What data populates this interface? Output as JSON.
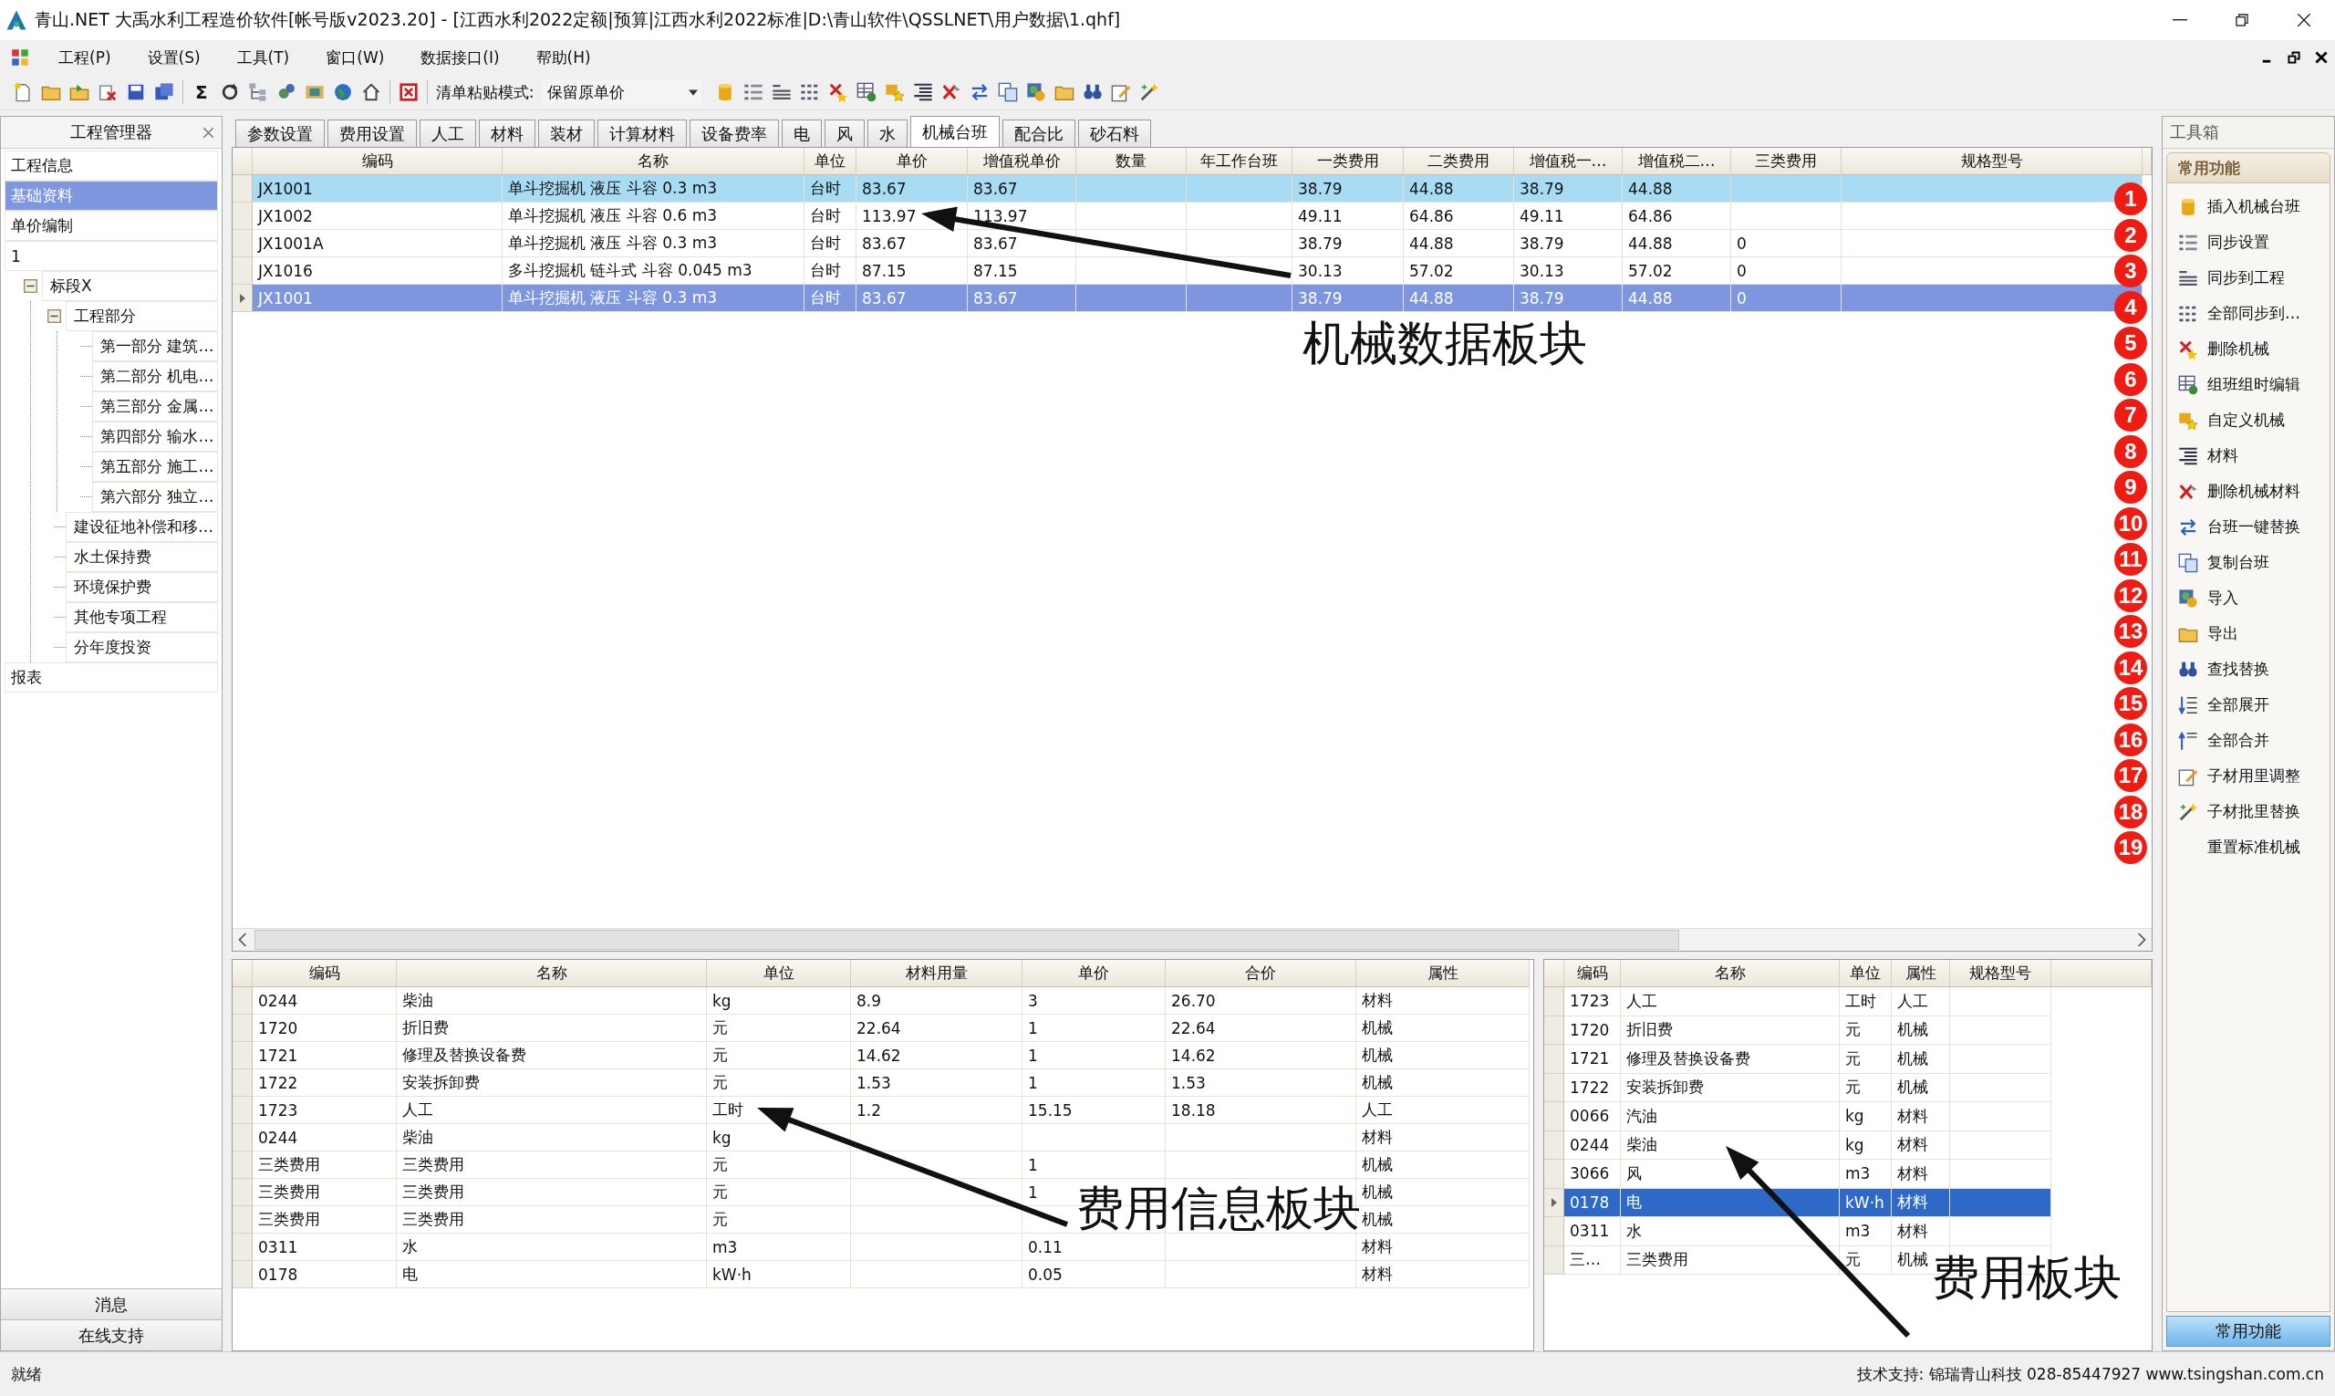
{
  "window": {
    "title": "青山.NET 大禹水利工程造价软件[帐号版v2023.20] - [江西水利2022定额|预算|江西水利2022标准|D:\\青山软件\\QSSLNET\\用户数据\\1.qhf]"
  },
  "menu": [
    "工程(P)",
    "设置(S)",
    "工具(T)",
    "窗口(W)",
    "数据接口(I)",
    "帮助(H)"
  ],
  "toolbar": {
    "sum_glyph": "Σ",
    "paste_mode_label": "清单粘贴模式:",
    "paste_mode_value": "保留原单价"
  },
  "project_manager": {
    "title": "工程管理器",
    "items": [
      {
        "label": "工程信息",
        "selected": false
      },
      {
        "label": "基础资料",
        "selected": true
      },
      {
        "label": "单价编制",
        "selected": false
      },
      {
        "label": "1",
        "selected": false
      },
      {
        "label": "标段X",
        "selected": false,
        "expanded": true,
        "children": [
          {
            "label": "工程部分",
            "selected": false,
            "expanded": true,
            "children": [
              {
                "label": "第一部分 建筑…",
                "selected": false
              },
              {
                "label": "第二部分 机电…",
                "selected": false
              },
              {
                "label": "第三部分 金属…",
                "selected": false
              },
              {
                "label": "第四部分 输水…",
                "selected": false
              },
              {
                "label": "第五部分 施工…",
                "selected": false
              },
              {
                "label": "第六部分 独立…",
                "selected": false
              }
            ]
          },
          {
            "label": "建设征地补偿和移…",
            "selected": false
          },
          {
            "label": "水土保持费",
            "selected": false
          },
          {
            "label": "环境保护费",
            "selected": false
          },
          {
            "label": "其他专项工程",
            "selected": false
          },
          {
            "label": "分年度投资",
            "selected": false
          }
        ]
      },
      {
        "label": "报表",
        "selected": false
      }
    ],
    "footer_buttons": [
      "消息",
      "在线支持"
    ]
  },
  "tabs": [
    {
      "label": "参数设置",
      "selected": false
    },
    {
      "label": "费用设置",
      "selected": false
    },
    {
      "label": "人工",
      "selected": false
    },
    {
      "label": "材料",
      "selected": false
    },
    {
      "label": "装材",
      "selected": false
    },
    {
      "label": "计算材料",
      "selected": false
    },
    {
      "label": "设备费率",
      "selected": false
    },
    {
      "label": "电",
      "selected": false
    },
    {
      "label": "风",
      "selected": false
    },
    {
      "label": "水",
      "selected": false
    },
    {
      "label": "机械台班",
      "selected": true
    },
    {
      "label": "配合比",
      "selected": false
    },
    {
      "label": "砂石料",
      "selected": false
    }
  ],
  "machine_table": {
    "columns": [
      "编码",
      "名称",
      "单位",
      "单价",
      "增值税单价",
      "数量",
      "年工作台班",
      "一类费用",
      "二类费用",
      "增值税一…",
      "增值税二…",
      "三类费用",
      "规格型号"
    ],
    "rows": [
      {
        "cells": [
          "JX1001",
          "单斗挖掘机 液压 斗容 0.3 m3",
          "台时",
          "83.67",
          "83.67",
          null,
          null,
          "38.79",
          "44.88",
          "38.79",
          "44.88",
          null,
          null
        ],
        "selected": false,
        "highlighted": true
      },
      {
        "cells": [
          "JX1002",
          "单斗挖掘机 液压 斗容 0.6 m3",
          "台时",
          "113.97",
          "113.97",
          null,
          null,
          "49.11",
          "64.86",
          "49.11",
          "64.86",
          null,
          null
        ],
        "selected": false,
        "highlighted": false
      },
      {
        "cells": [
          "JX1001A",
          "单斗挖掘机 液压 斗容 0.3 m3",
          "台时",
          "83.67",
          "83.67",
          null,
          null,
          "38.79",
          "44.88",
          "38.79",
          "44.88",
          "0",
          null
        ],
        "selected": false,
        "highlighted": false
      },
      {
        "cells": [
          "JX1016",
          "多斗挖掘机 链斗式 斗容 0.045 m3",
          "台时",
          "87.15",
          "87.15",
          null,
          null,
          "30.13",
          "57.02",
          "30.13",
          "57.02",
          "0",
          null
        ],
        "selected": false,
        "highlighted": false
      },
      {
        "cells": [
          "JX1001",
          "单斗挖掘机 液压 斗容 0.3 m3",
          "台时",
          "83.67",
          "83.67",
          null,
          null,
          "38.79",
          "44.88",
          "38.79",
          "44.88",
          "0",
          null
        ],
        "selected": true,
        "highlighted": false
      }
    ]
  },
  "cost_info_table": {
    "columns": [
      "编码",
      "名称",
      "单位",
      "材料用量",
      "单价",
      "合价",
      "属性"
    ],
    "rows": [
      {
        "cells": [
          "0244",
          "柴油",
          "kg",
          "8.9",
          "3",
          "26.70",
          "材料"
        ],
        "selected": false
      },
      {
        "cells": [
          "1720",
          "折旧费",
          "元",
          "22.64",
          "1",
          "22.64",
          "机械"
        ],
        "selected": false
      },
      {
        "cells": [
          "1721",
          "修理及替换设备费",
          "元",
          "14.62",
          "1",
          "14.62",
          "机械"
        ],
        "selected": false
      },
      {
        "cells": [
          "1722",
          "安装拆卸费",
          "元",
          "1.53",
          "1",
          "1.53",
          "机械"
        ],
        "selected": false
      },
      {
        "cells": [
          "1723",
          "人工",
          "工时",
          "1.2",
          "15.15",
          "18.18",
          "人工"
        ],
        "selected": false
      },
      {
        "cells": [
          "0244",
          "柴油",
          "kg",
          null,
          null,
          null,
          "材料"
        ],
        "selected": false
      },
      {
        "cells": [
          "三类费用",
          "三类费用",
          "元",
          null,
          "1",
          null,
          "机械"
        ],
        "selected": false
      },
      {
        "cells": [
          "三类费用",
          "三类费用",
          "元",
          null,
          "1",
          null,
          "机械"
        ],
        "selected": false
      },
      {
        "cells": [
          "三类费用",
          "三类费用",
          "元",
          null,
          null,
          null,
          "机械"
        ],
        "selected": false
      },
      {
        "cells": [
          "0311",
          "水",
          "m3",
          null,
          "0.11",
          null,
          "材料"
        ],
        "selected": false
      },
      {
        "cells": [
          "0178",
          "电",
          "kW·h",
          null,
          "0.05",
          null,
          "材料"
        ],
        "selected": false
      }
    ]
  },
  "cost_table": {
    "columns": [
      "编码",
      "名称",
      "单位",
      "属性",
      "规格型号"
    ],
    "rows": [
      {
        "cells": [
          "1723",
          "人工",
          "工时",
          "人工",
          null
        ],
        "selected": false
      },
      {
        "cells": [
          "1720",
          "折旧费",
          "元",
          "机械",
          null
        ],
        "selected": false
      },
      {
        "cells": [
          "1721",
          "修理及替换设备费",
          "元",
          "机械",
          null
        ],
        "selected": false
      },
      {
        "cells": [
          "1722",
          "安装拆卸费",
          "元",
          "机械",
          null
        ],
        "selected": false
      },
      {
        "cells": [
          "0066",
          "汽油",
          "kg",
          "材料",
          null
        ],
        "selected": false
      },
      {
        "cells": [
          "0244",
          "柴油",
          "kg",
          "材料",
          null
        ],
        "selected": false
      },
      {
        "cells": [
          "3066",
          "风",
          "m3",
          "材料",
          null
        ],
        "selected": false
      },
      {
        "cells": [
          "0178",
          "电",
          "kW·h",
          "材料",
          null
        ],
        "selected": true
      },
      {
        "cells": [
          "0311",
          "水",
          "m3",
          "材料",
          null
        ],
        "selected": false
      },
      {
        "cells": [
          "三…",
          "三类费用",
          "元",
          "机械",
          null
        ],
        "selected": false
      }
    ]
  },
  "toolbox": {
    "title": "工具箱",
    "section": "常用功能",
    "items": [
      "插入机械台班",
      "同步设置",
      "同步到工程",
      "全部同步到…",
      "删除机械",
      "组班组时编辑",
      "自定义机械",
      "材料",
      "删除机械材料",
      "台班一键替换",
      "复制台班",
      "导入",
      "导出",
      "查找替换",
      "全部展开",
      "全部合并",
      "子材用里调整",
      "子材批里替换",
      "重置标准机械"
    ],
    "footer_tab": "常用功能"
  },
  "annotations": {
    "markers": [
      "1",
      "2",
      "3",
      "4",
      "5",
      "6",
      "7",
      "8",
      "9",
      "10",
      "11",
      "12",
      "13",
      "14",
      "15",
      "16",
      "17",
      "18",
      "19"
    ],
    "labels": [
      "机械数据板块",
      "费用信息板块",
      "费用板块"
    ]
  },
  "status_bar": {
    "status": "就绪",
    "support": "技术支持: 锦瑞青山科技 028-85447927 www.tsingshan.com.cn"
  }
}
